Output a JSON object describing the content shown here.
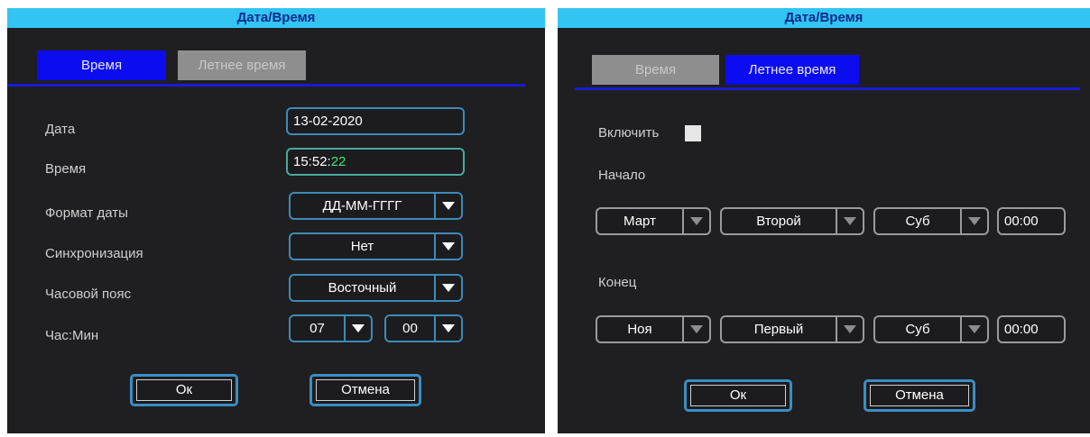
{
  "left_panel": {
    "title": "Дата/Время",
    "tabs": [
      {
        "label": "Время",
        "active": true
      },
      {
        "label": "Летнее время",
        "active": false
      }
    ],
    "rows": {
      "date_label": "Дата",
      "date_value": "13-02-2020",
      "time_label": "Время",
      "time_value_hm": "15:52:",
      "time_value_s": "22",
      "format_label": "Формат даты",
      "format_value": "ДД-ММ-ГГГГ",
      "sync_label": "Синхронизация",
      "sync_value": "Нет",
      "tz_label": "Часовой пояс",
      "tz_value": "Восточный",
      "hm_label": "Час:Мин",
      "hour_value": "07",
      "minute_value": "00"
    },
    "buttons": {
      "ok": "Ок",
      "cancel": "Отмена"
    }
  },
  "right_panel": {
    "title": "Дата/Время",
    "tabs": [
      {
        "label": "Время",
        "active": false
      },
      {
        "label": "Летнее время",
        "active": true
      }
    ],
    "enable_label": "Включить",
    "enable_checked": false,
    "start_label": "Начало",
    "start": {
      "month": "Март",
      "week": "Второй",
      "day": "Суб",
      "time": "00:00"
    },
    "end_label": "Конец",
    "end": {
      "month": "Ноя",
      "week": "Первый",
      "day": "Суб",
      "time": "00:00"
    },
    "buttons": {
      "ok": "Ок",
      "cancel": "Отмена"
    }
  },
  "colors": {
    "title_bar": "#33c4f2",
    "active_tab": "#0c0cf0",
    "inactive_tab": "#8e8e8e",
    "field_border": "#3d8ab8",
    "seconds_text": "#44e27a"
  },
  "icons": [
    "dropdown-arrow-icon"
  ]
}
